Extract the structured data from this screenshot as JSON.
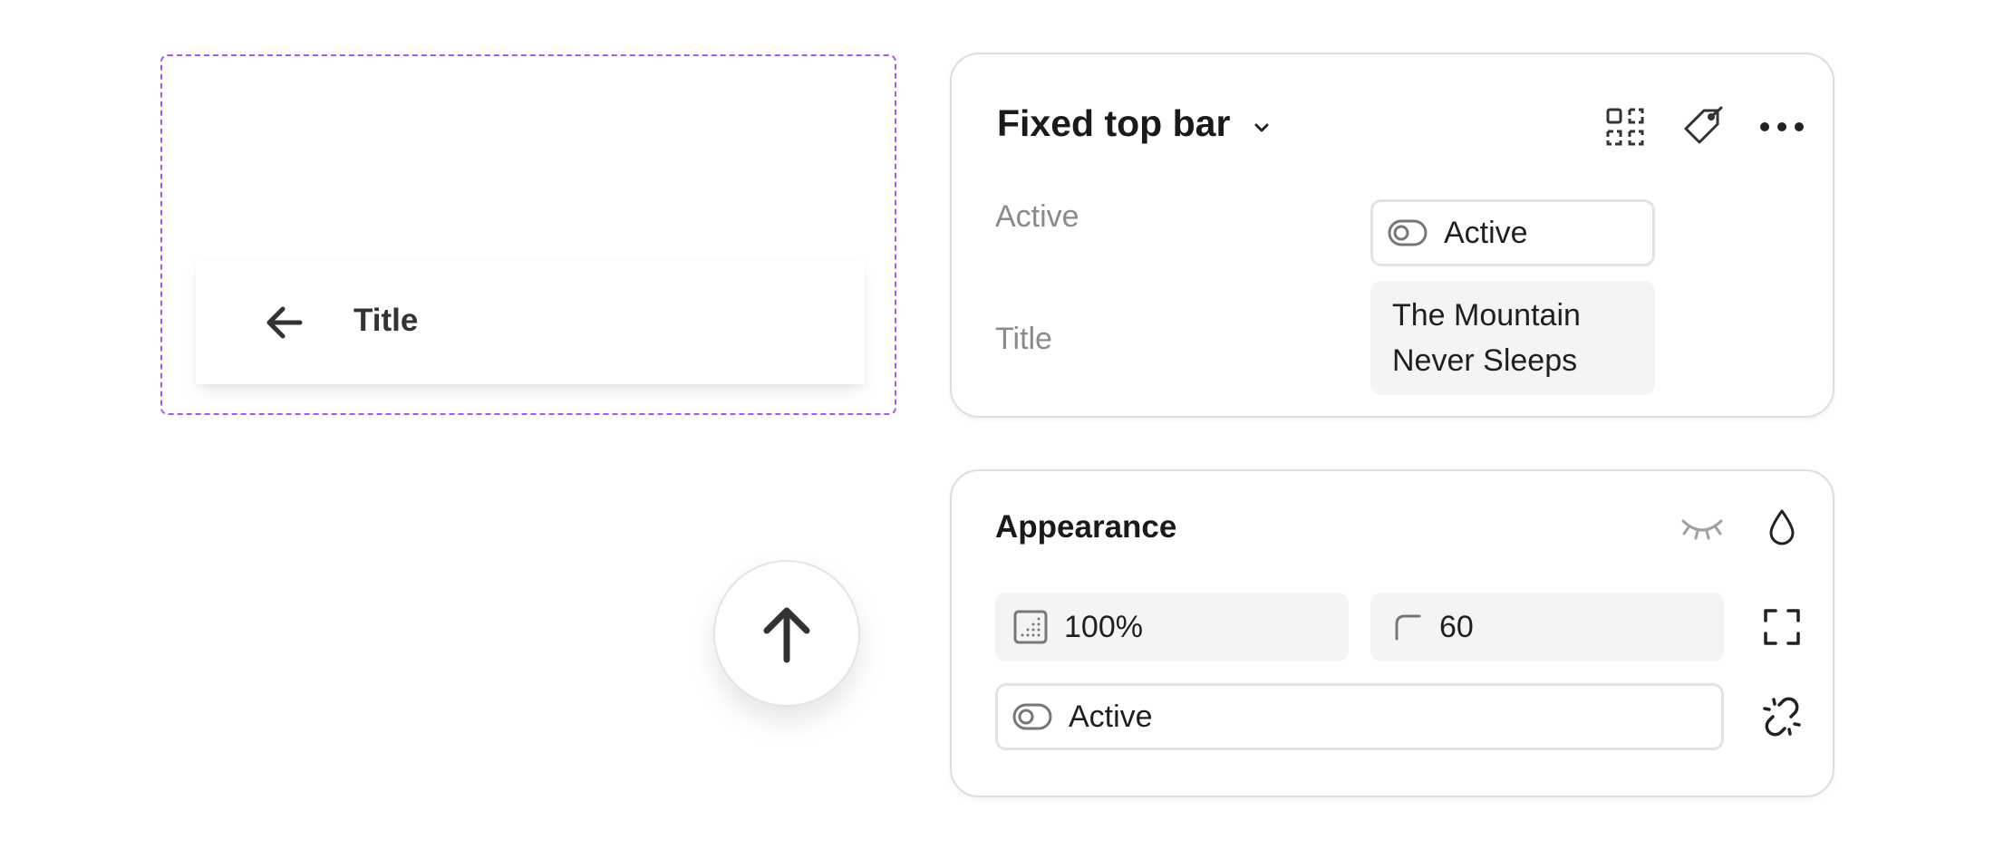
{
  "preview": {
    "bar_title": "Title"
  },
  "component_panel": {
    "title": "Fixed top bar",
    "icons": [
      "chevron-down-icon",
      "select-layer-icon",
      "tag-icon",
      "more-icon"
    ],
    "properties": [
      {
        "label": "Active",
        "value": "Active",
        "icon": "toggle-icon"
      },
      {
        "label": "Title",
        "value": "The Mountain Never Sleeps"
      }
    ]
  },
  "appearance_panel": {
    "title": "Appearance",
    "icons": [
      "eye-closed-icon",
      "drop-icon",
      "expand-icon",
      "unlink-icon"
    ],
    "opacity": "100%",
    "radius": "60",
    "visibility": "Active"
  },
  "colors": {
    "selection_outline": "#a855f7",
    "panel_border": "#dedede",
    "field_fill": "#f4f4f4"
  }
}
